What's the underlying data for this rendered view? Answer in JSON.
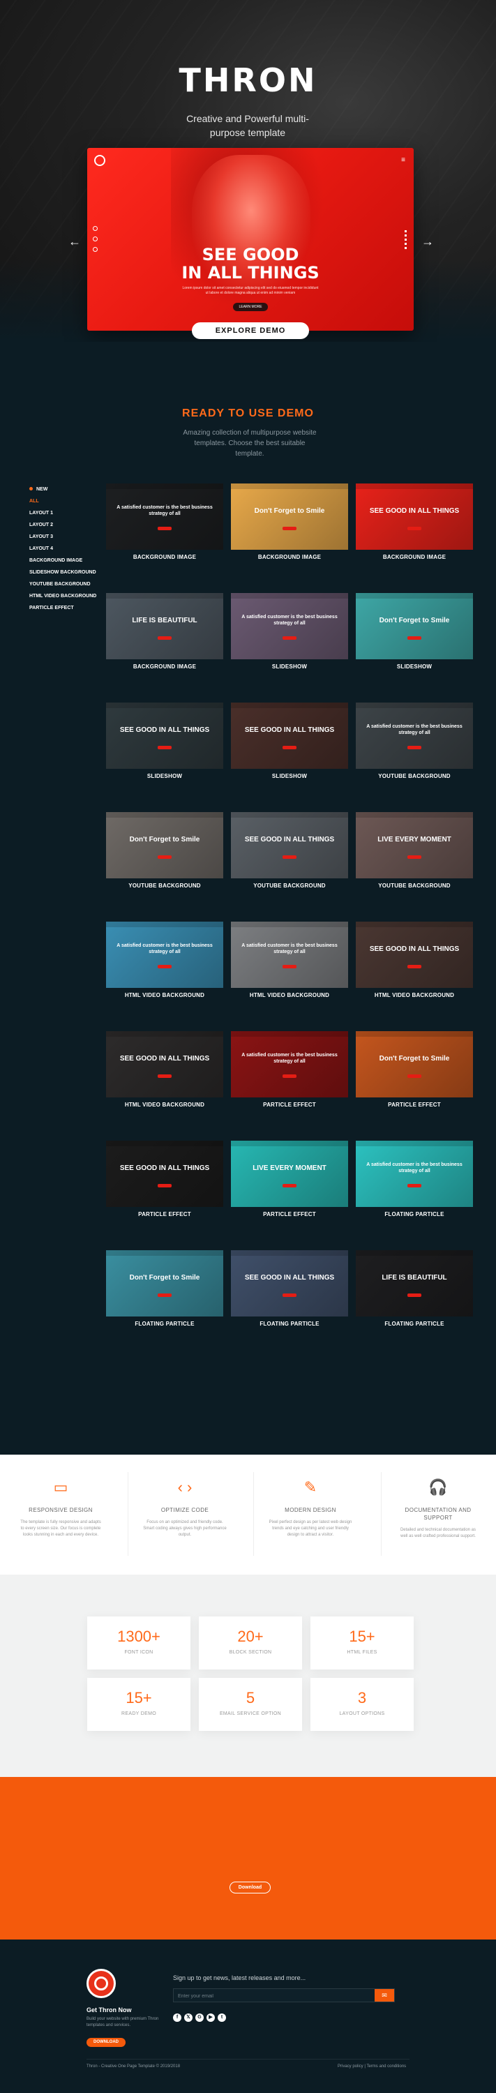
{
  "hero": {
    "title": "THRON",
    "subtitle": "Creative and Powerful multi-purpose template",
    "prev_arrow": "←",
    "next_arrow": "→",
    "preview": {
      "menu_icon": "≡",
      "headline_line1": "SEE GOOD",
      "headline_line2": "IN ALL THINGS",
      "body": "Lorem ipsum dolor sit amet consectetur adipiscing elit sed do eiusmod tempor incididunt ut labore et dolore magna aliqua ut enim ad minim veniam",
      "button": "LEARN MORE"
    },
    "explore_button": "EXPLORE DEMO"
  },
  "ready": {
    "title": "READY TO USE DEMO",
    "subtitle": "Amazing collection of multipurpose website templates. Choose the best suitable template."
  },
  "filters": [
    "NEW",
    "ALL",
    "LAYOUT 1",
    "LAYOUT 2",
    "LAYOUT 3",
    "LAYOUT 4",
    "BACKGROUND IMAGE",
    "SLIDESHOW BACKGROUND",
    "YOUTUBE BACKGROUND",
    "HTML VIDEO BACKGROUND",
    "PARTICLE EFFECT"
  ],
  "demos": [
    {
      "label": "BACKGROUND IMAGE",
      "text": "A satisfied customer is the best business strategy of all",
      "bg": "#1d1f21"
    },
    {
      "label": "BACKGROUND IMAGE",
      "text": "Don't Forget to Smile",
      "bg": "#e8a94a"
    },
    {
      "label": "BACKGROUND IMAGE",
      "text": "SEE GOOD IN ALL THINGS",
      "bg": "#e8221a"
    },
    {
      "label": "BACKGROUND IMAGE",
      "text": "LIFE IS BEAUTIFUL",
      "bg": "#4d5760"
    },
    {
      "label": "SLIDESHOW",
      "text": "A satisfied customer is the best business strategy of all",
      "bg": "#6b5a72"
    },
    {
      "label": "SLIDESHOW",
      "text": "Don't Forget to Smile",
      "bg": "#3ea7a6"
    },
    {
      "label": "SLIDESHOW",
      "text": "SEE GOOD IN ALL THINGS",
      "bg": "#2f3a3e"
    },
    {
      "label": "SLIDESHOW",
      "text": "SEE GOOD IN ALL THINGS",
      "bg": "#4a2f2a"
    },
    {
      "label": "YOUTUBE BACKGROUND",
      "text": "A satisfied customer is the best business strategy of all",
      "bg": "#3d4448"
    },
    {
      "label": "YOUTUBE BACKGROUND",
      "text": "Don't Forget to Smile",
      "bg": "#6f6a66"
    },
    {
      "label": "YOUTUBE BACKGROUND",
      "text": "SEE GOOD IN ALL THINGS",
      "bg": "#5a6066"
    },
    {
      "label": "YOUTUBE BACKGROUND",
      "text": "LIVE EVERY MOMENT",
      "bg": "#6d5855"
    },
    {
      "label": "HTML VIDEO BACKGROUND",
      "text": "A satisfied customer is the best business strategy of all",
      "bg": "#3a8fb4"
    },
    {
      "label": "HTML VIDEO BACKGROUND",
      "text": "A satisfied customer is the best business strategy of all",
      "bg": "#7d7f82"
    },
    {
      "label": "HTML VIDEO BACKGROUND",
      "text": "SEE GOOD IN ALL THINGS",
      "bg": "#4a3732"
    },
    {
      "label": "HTML VIDEO BACKGROUND",
      "text": "SEE GOOD IN ALL THINGS",
      "bg": "#2d2b2b"
    },
    {
      "label": "PARTICLE EFFECT",
      "text": "A satisfied customer is the best business strategy of all",
      "bg": "#8b1414"
    },
    {
      "label": "PARTICLE EFFECT",
      "text": "Don't Forget to Smile",
      "bg": "#c5561e"
    },
    {
      "label": "PARTICLE EFFECT",
      "text": "SEE GOOD IN ALL THINGS",
      "bg": "#1c1c1c"
    },
    {
      "label": "PARTICLE EFFECT",
      "text": "LIVE EVERY MOMENT",
      "bg": "#27b8b3"
    },
    {
      "label": "FLOATING PARTICLE",
      "text": "A satisfied customer is the best business strategy of all",
      "bg": "#2cc2c0"
    },
    {
      "label": "FLOATING PARTICLE",
      "text": "Don't Forget to Smile",
      "bg": "#3a8fa0"
    },
    {
      "label": "FLOATING PARTICLE",
      "text": "SEE GOOD IN ALL THINGS",
      "bg": "#40506a"
    },
    {
      "label": "FLOATING PARTICLE",
      "text": "LIFE IS BEAUTIFUL",
      "bg": "#1e1e20"
    }
  ],
  "features": [
    {
      "icon": "laptop-icon",
      "glyph": "▭",
      "title": "RESPONSIVE DESIGN",
      "desc": "The template is fully responsive and adapts to every screen size. Our focus is complete looks stunning in each and every device."
    },
    {
      "icon": "code-icon",
      "glyph": "‹ ›",
      "title": "OPTIMIZE CODE",
      "desc": "Focus on an optimized and friendly code. Smart coding always gives high performance output."
    },
    {
      "icon": "brush-icon",
      "glyph": "✎",
      "title": "MODERN DESIGN",
      "desc": "Pixel perfect design as per latest web design trends and eye catching and user friendly design to attract a visitor."
    },
    {
      "icon": "headphones-icon",
      "glyph": "🎧",
      "title": "DOCUMENTATION AND SUPPORT",
      "desc": "Detailed and technical documentation as well as well crafted professional support."
    }
  ],
  "stats": [
    {
      "number": "1300+",
      "label": "FONT ICON"
    },
    {
      "number": "20+",
      "label": "BLOCK SECTION"
    },
    {
      "number": "15+",
      "label": "HTML FILES"
    },
    {
      "number": "15+",
      "label": "READY DEMO"
    },
    {
      "number": "5",
      "label": "EMAIL SERVICE OPTION"
    },
    {
      "number": "3",
      "label": "LAYOUT OPTIONS"
    }
  ],
  "cta": {
    "button": "Download"
  },
  "footer": {
    "name": "Get Thron Now",
    "desc": "Build your website with premium Thron templates and services.",
    "button": "DOWNLOAD",
    "signup": "Sign up to get news, latest releases and more...",
    "email_placeholder": "Enter your email",
    "submit_icon": "✉",
    "social": [
      "f",
      "𝕏",
      "G",
      "▶",
      "t"
    ],
    "copyright": "Thron - Creative One Page Template © 2019/2018",
    "links": "Privacy policy   |   Terms and conditions"
  },
  "colors": {
    "accent": "#ff6a1a",
    "dark": "#0c1c24",
    "orange_band": "#f45a0c"
  }
}
